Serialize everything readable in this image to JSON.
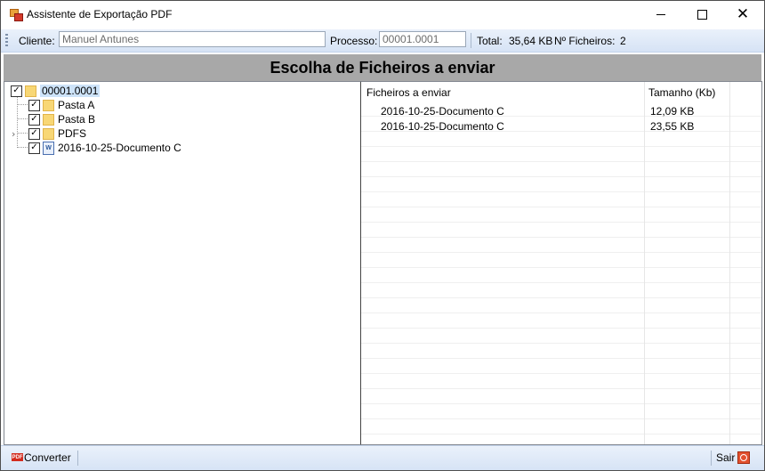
{
  "window": {
    "title": "Assistente de Exportação PDF"
  },
  "toolbar": {
    "cliente_label": "Cliente:",
    "cliente_value": "Manuel Antunes",
    "processo_label": "Processo:",
    "processo_value": "00001.0001",
    "total_label": "Total:",
    "total_value": "35,64 KB",
    "nfiles_label": "Nº Ficheiros:",
    "nfiles_value": "2"
  },
  "heading": "Escolha de Ficheiros a enviar",
  "tree": {
    "root": {
      "label": "00001.0001",
      "checked": true
    },
    "children": [
      {
        "label": "Pasta A",
        "icon": "folder-icon",
        "checked": true
      },
      {
        "label": "Pasta B",
        "icon": "folder-icon",
        "checked": true
      },
      {
        "label": "PDFS",
        "icon": "folder-icon",
        "checked": true,
        "expandable": true
      },
      {
        "label": "2016-10-25-Documento C",
        "icon": "word-document-icon",
        "checked": true
      }
    ]
  },
  "list": {
    "columns": [
      "Ficheiros a enviar",
      "Tamanho (Kb)"
    ],
    "rows": [
      {
        "name": "2016-10-25-Documento C",
        "size": "12,09 KB"
      },
      {
        "name": "2016-10-25-Documento C",
        "size": "23,55 KB"
      }
    ]
  },
  "statusbar": {
    "convert_label": "Converter",
    "exit_label": "Sair"
  }
}
